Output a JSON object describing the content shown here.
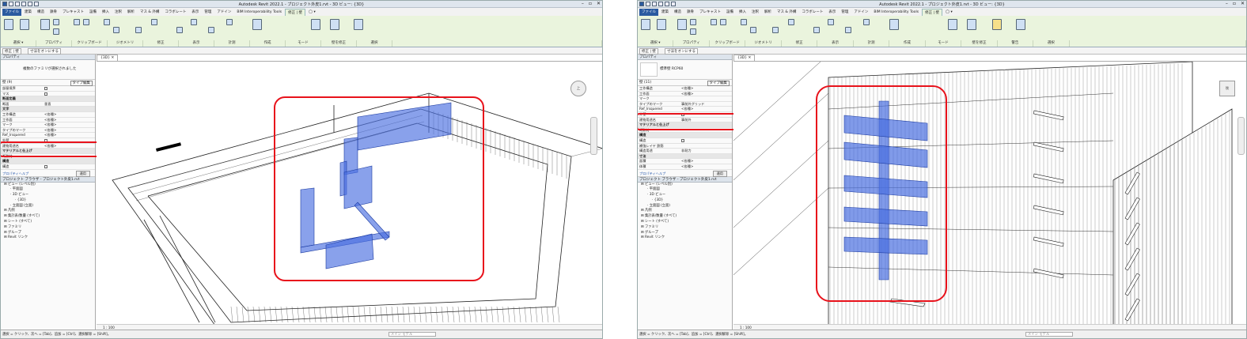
{
  "windows": [
    {
      "title": "Autodesk Revit 2022.1 - プロジェクト外皮1.rvt - 3D ビュー: {3D}",
      "tabs": [
        "ファイル",
        "建築",
        "構造",
        "鉄骨",
        "プレキャスト",
        "設備",
        "挿入",
        "注釈",
        "解析",
        "マス & 外構",
        "コラボレート",
        "表示",
        "管理",
        "アドイン",
        "BIM Interoperability Tools",
        "修正 | 壁",
        "◯ ▾"
      ],
      "ribbon_groups": [
        "選択 ▾",
        "プロパティ",
        "クリップボード",
        "ジオメトリ",
        "修正",
        "表示",
        "計測",
        "作成",
        "モード",
        "壁を修正",
        "選択"
      ],
      "context_tabs": [
        "修正 | 壁",
        "寸法をオンにする"
      ],
      "properties": {
        "header": "プロパティ",
        "type_name": "複数のファミリが選択されました",
        "instance": "壁 (9)",
        "edit_type": "タイプ編集",
        "rows": [
          {
            "k": "部屋境界",
            "v": "",
            "cat": false,
            "chk": true
          },
          {
            "k": "マス",
            "v": "",
            "cat": false,
            "chk": true
          },
          {
            "k": "断面定義",
            "v": "",
            "cat": true
          },
          {
            "k": "断面",
            "v": "垂直",
            "cat": false
          },
          {
            "k": "文字",
            "v": "",
            "cat": true
          },
          {
            "k": "工作構造",
            "v": "<各種>",
            "cat": false
          },
          {
            "k": "工作面",
            "v": "<各種>",
            "cat": false
          },
          {
            "k": "マーク",
            "v": "<各種>",
            "cat": false
          },
          {
            "k": "タイプのマーク",
            "v": "<各種>",
            "cat": false
          },
          {
            "k": "Ref_Irsquered",
            "v": "<各種>",
            "cat": false
          },
          {
            "k": "外壁",
            "v": "",
            "cat": false,
            "chk": true
          },
          {
            "k": "建物用途名",
            "v": "<各種>",
            "cat": false
          },
          {
            "k": "マテリアルと仕上げ",
            "v": "",
            "cat": true
          },
          {
            "k": "断熱材",
            "v": "",
            "cat": false
          },
          {
            "k": "構造",
            "v": "",
            "cat": true
          },
          {
            "k": "構造",
            "v": "",
            "cat": false,
            "chk": true
          }
        ],
        "help": "プロパティヘルプ",
        "apply": "適用"
      },
      "browser": {
        "header": "プロジェクト ブラウザ - プロジェクト外皮1.rvt",
        "items": [
          "ビュー (レベル別)",
          "平面図",
          "3D ビュー",
          "{3D}",
          "立面図 (立面)",
          "凡例",
          "集計表/数量 (すべて)",
          "シート (すべて)",
          "ファミリ",
          "グループ",
          "Revit リンク"
        ]
      },
      "view_tab": "{3D}",
      "view_scale": "1 : 100",
      "status_text": "選択 = クリック、次へ = [Tab]、追加 = [Ctrl]、選択解除 = [Shift]。",
      "model_field": "メイン モデル",
      "navcube": "上"
    },
    {
      "title": "Autodesk Revit 2022.1 - プロジェクト外皮1.rvt - 3D ビュー: {3D}",
      "tabs": [
        "ファイル",
        "建築",
        "構造",
        "鉄骨",
        "プレキャスト",
        "設備",
        "挿入",
        "注釈",
        "解析",
        "マス & 外構",
        "コラボレート",
        "表示",
        "管理",
        "アドイン",
        "BIM Interoperability Tools",
        "修正 | 壁",
        "◯ ▾"
      ],
      "ribbon_groups": [
        "選択 ▾",
        "プロパティ",
        "クリップボード",
        "ジオメトリ",
        "修正",
        "表示",
        "計測",
        "作成",
        "モード",
        "壁を修正",
        "警告",
        "選択"
      ],
      "context_tabs": [
        "修正 | 壁",
        "寸法をオンにする"
      ],
      "properties": {
        "header": "プロパティ",
        "type_name": "標準壁 RCP60",
        "instance": "壁 (11)",
        "edit_type": "タイプ編集",
        "rows": [
          {
            "k": "工作構造",
            "v": "<各種>",
            "cat": false
          },
          {
            "k": "工作面",
            "v": "<各種>",
            "cat": false
          },
          {
            "k": "マーク",
            "v": "",
            "cat": false
          },
          {
            "k": "タイプのマーク",
            "v": "事前外グリッド",
            "cat": false
          },
          {
            "k": "Ref_Irsquered",
            "v": "<各種>",
            "cat": false
          },
          {
            "k": "外壁",
            "v": "",
            "cat": false,
            "chk": true
          },
          {
            "k": "建物用途名",
            "v": "事前外",
            "cat": false
          },
          {
            "k": "マテリアルと仕上げ",
            "v": "",
            "cat": true
          },
          {
            "k": "断熱材",
            "v": "",
            "cat": false
          },
          {
            "k": "構造",
            "v": "",
            "cat": true
          },
          {
            "k": "構造",
            "v": "",
            "cat": false,
            "chk": true
          },
          {
            "k": "補強レイヤ 鉄筋",
            "v": "",
            "cat": false
          },
          {
            "k": "構造用途",
            "v": "非耐力",
            "cat": false
          },
          {
            "k": "寸法",
            "v": "",
            "cat": true
          },
          {
            "k": "面積",
            "v": "<各種>",
            "cat": false
          },
          {
            "k": "体積",
            "v": "<各種>",
            "cat": false
          }
        ],
        "help": "プロパティヘルプ",
        "apply": "適用"
      },
      "browser": {
        "header": "プロジェクト ブラウザ - プロジェクト外皮1.rvt",
        "items": [
          "ビュー (レベル別)",
          "平面図",
          "3D ビュー",
          "{3D}",
          "立面図 (立面)",
          "凡例",
          "集計表/数量 (すべて)",
          "シート (すべて)",
          "ファミリ",
          "グループ",
          "Revit リンク"
        ]
      },
      "view_tab": "{3D}",
      "view_scale": "1 : 100",
      "status_text": "選択 = クリック、次へ = [Tab]、追加 = [Ctrl]、選択解除 = [Shift]。",
      "model_field": "メイン モデル",
      "navcube": "後"
    }
  ],
  "colors": {
    "highlight": "#e8121b",
    "selection": "#4a6fe0",
    "file_tab": "#2a5aa0",
    "ribbon": "#eaf4dd"
  }
}
